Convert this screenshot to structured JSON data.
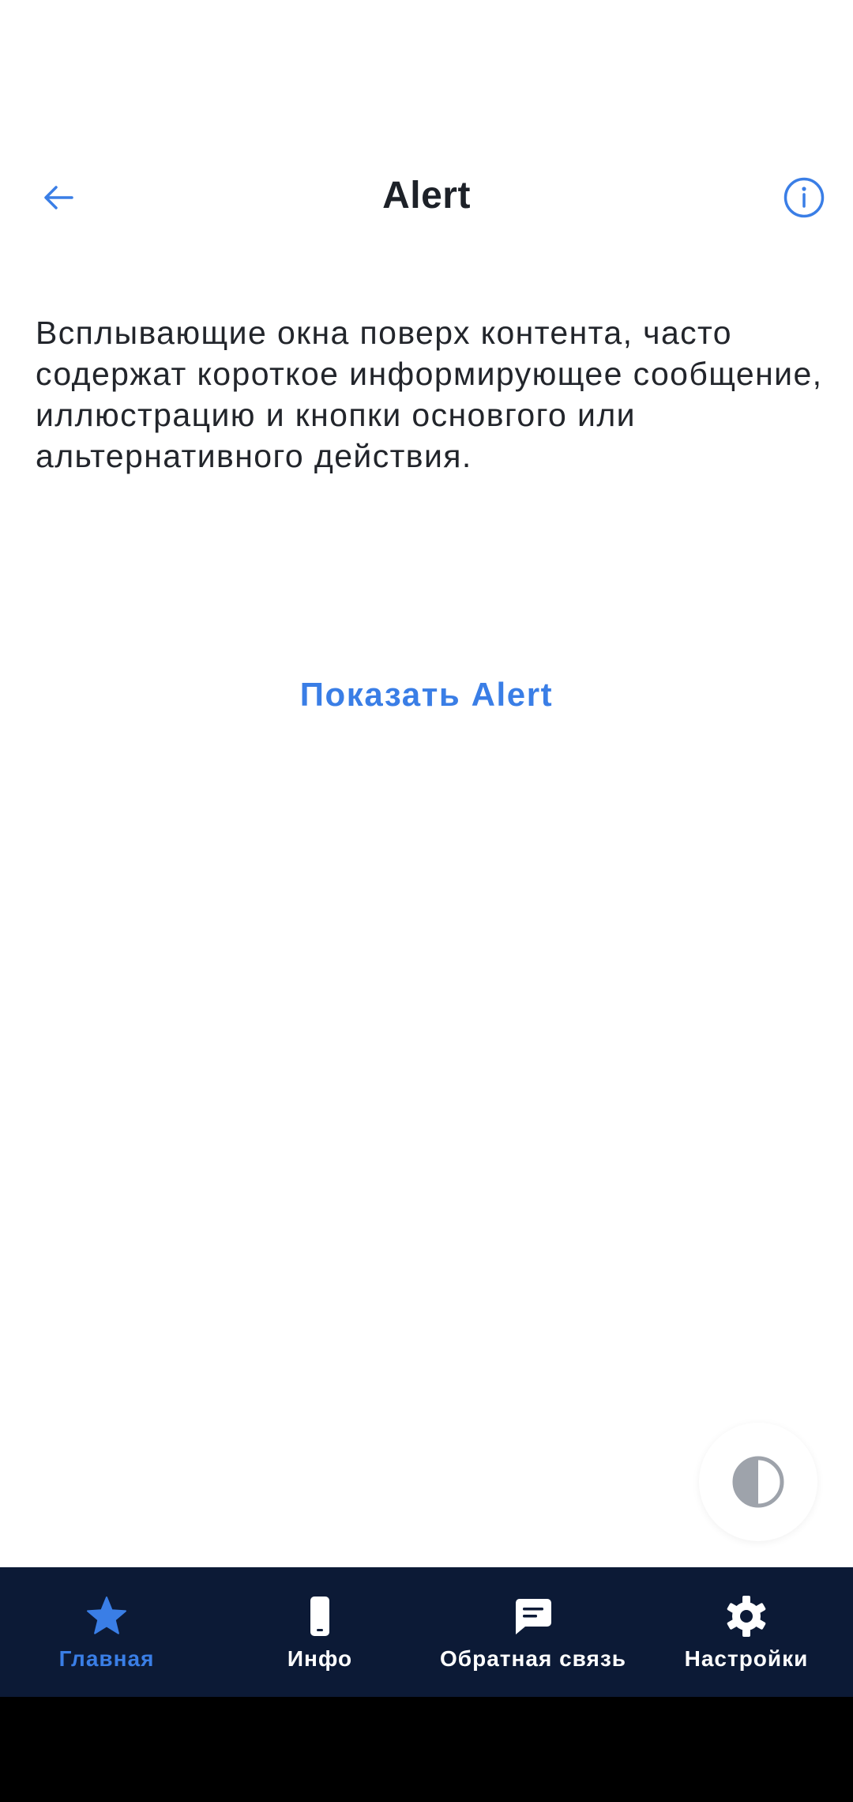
{
  "header": {
    "title": "Alert",
    "back_icon": "arrow-left-icon",
    "info_icon": "info-circle-icon"
  },
  "content": {
    "description": "Всплывающие окна поверх контента, часто содержат короткое информирующее сообщение, иллюстрацию и кнопки основгого или альтернативного действия.",
    "show_alert_label": "Показать Alert"
  },
  "fab": {
    "icon": "contrast-icon"
  },
  "bottom_nav": {
    "items": [
      {
        "label": "Главная",
        "icon": "star-icon",
        "active": true
      },
      {
        "label": "Инфо",
        "icon": "phone-icon",
        "active": false
      },
      {
        "label": "Обратная связь",
        "icon": "chat-icon",
        "active": false
      },
      {
        "label": "Настройки",
        "icon": "gear-icon",
        "active": false
      }
    ]
  },
  "colors": {
    "accent": "#3a7ee6",
    "nav_background": "#0c1a36",
    "text": "#22252b"
  }
}
